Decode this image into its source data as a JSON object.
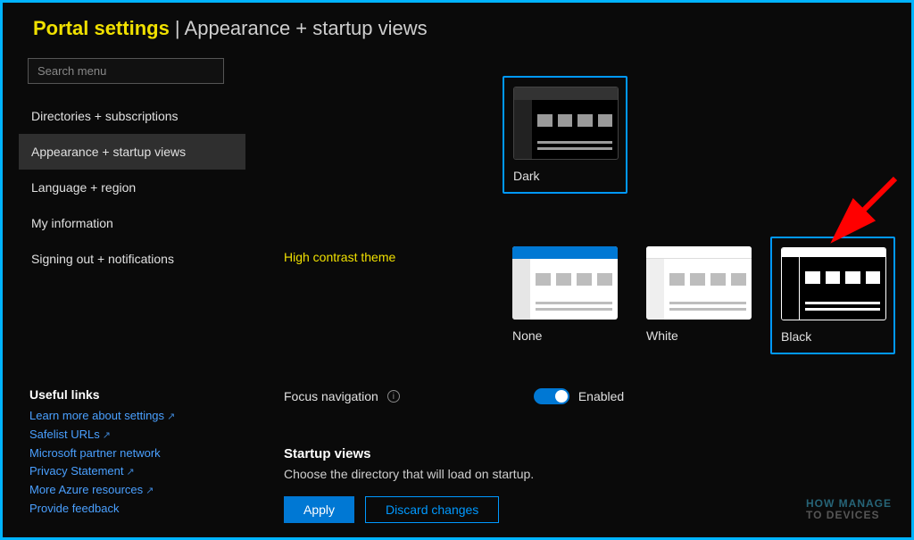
{
  "header": {
    "title_main": "Portal settings",
    "separator": " | ",
    "title_sub": "Appearance + startup views"
  },
  "sidebar": {
    "search_placeholder": "Search menu",
    "items": [
      {
        "label": "Directories + subscriptions",
        "selected": false
      },
      {
        "label": "Appearance + startup views",
        "selected": true
      },
      {
        "label": "Language + region",
        "selected": false
      },
      {
        "label": "My information",
        "selected": false
      },
      {
        "label": "Signing out + notifications",
        "selected": false
      }
    ],
    "useful_links_heading": "Useful links",
    "links": [
      {
        "label": "Learn more about settings",
        "external": true
      },
      {
        "label": "Safelist URLs",
        "external": true
      },
      {
        "label": "Microsoft partner network",
        "external": false
      },
      {
        "label": "Privacy Statement",
        "external": true
      },
      {
        "label": "More Azure resources",
        "external": true
      },
      {
        "label": "Provide feedback",
        "external": false
      }
    ]
  },
  "main": {
    "theme_dark_label": "Dark",
    "high_contrast_heading": "High contrast theme",
    "contrast_options": {
      "none": "None",
      "white": "White",
      "black": "Black"
    },
    "focus_label": "Focus navigation",
    "focus_state": "Enabled",
    "startup_heading": "Startup views",
    "startup_description": "Choose the directory that will load on startup.",
    "apply_label": "Apply",
    "discard_label": "Discard changes"
  },
  "watermark": {
    "line1": "HOW MANAGE",
    "line2": "TO DEVICES"
  }
}
